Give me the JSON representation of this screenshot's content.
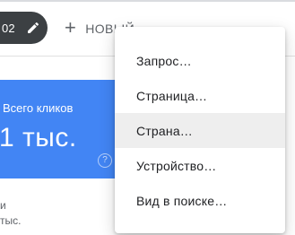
{
  "filter_chip": {
    "label": "02",
    "icon": "pencil-icon"
  },
  "new_button": {
    "label": "НОВЫЙ",
    "icon": "plus-icon"
  },
  "metric": {
    "label": "Всего кликов",
    "value": "1 тыс.",
    "icon": "help-icon",
    "accent_color": "#4285f4"
  },
  "background_text": {
    "line1": "и",
    "line2": "тыс."
  },
  "menu": {
    "items": [
      {
        "label": "Запрос…"
      },
      {
        "label": "Страница…"
      },
      {
        "label": "Страна…"
      },
      {
        "label": "Устройство…"
      },
      {
        "label": "Вид в поиске…"
      }
    ],
    "highlighted_item": "Страна…"
  }
}
